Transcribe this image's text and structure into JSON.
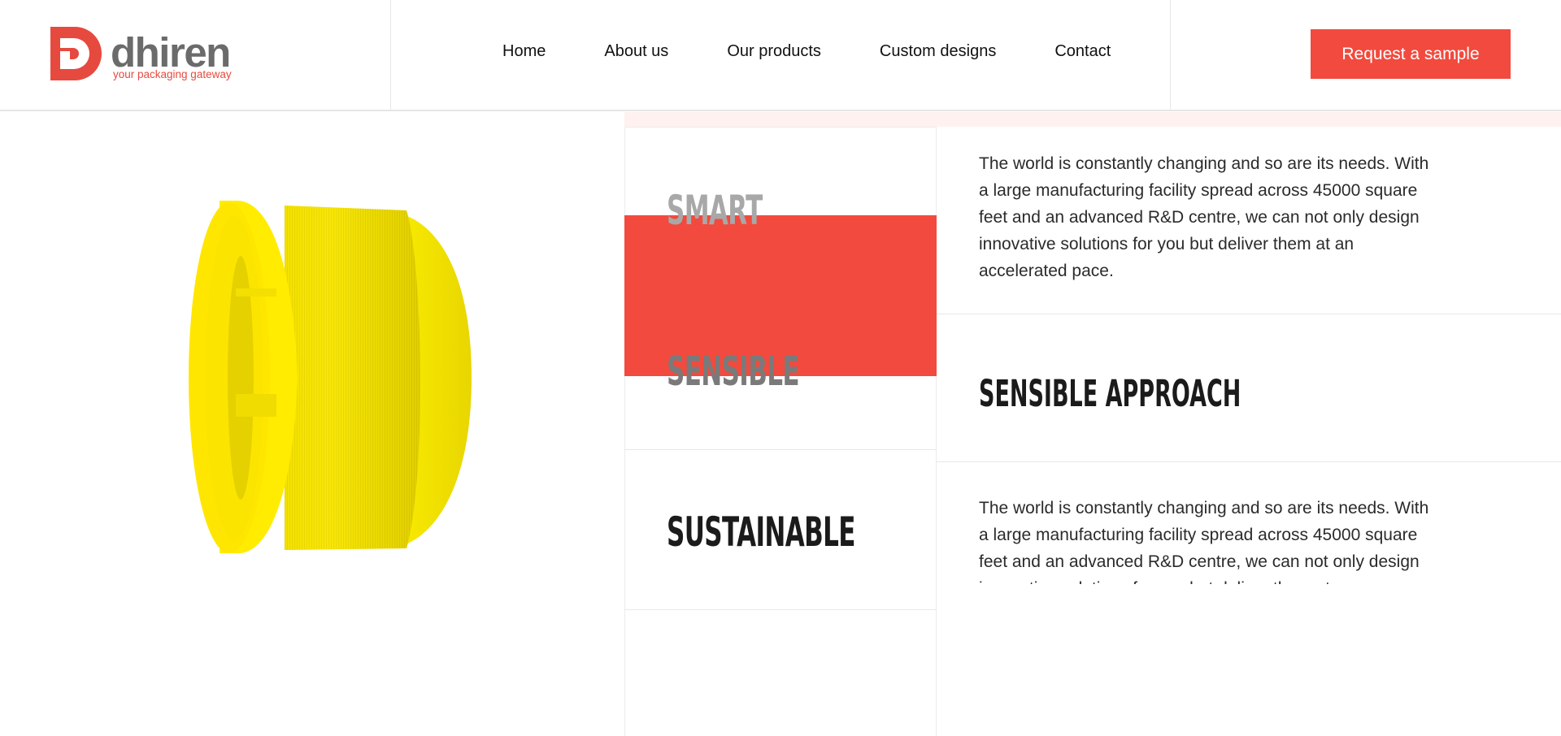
{
  "brand": {
    "name": "dhiren",
    "tagline": "your packaging gateway",
    "accent_color": "#f24a3e",
    "text_color": "#6b6b6b"
  },
  "nav": {
    "items": [
      "Home",
      "About us",
      "Our products",
      "Custom designs",
      "Contact"
    ]
  },
  "cta": {
    "label": "Request a sample"
  },
  "product": {
    "image": "yellow-bottle-cap"
  },
  "features": {
    "words": [
      "SMART",
      "SENSIBLE",
      "SUSTAINABLE"
    ],
    "active": "SENSIBLE",
    "paragraph_top": "The world is constantly changing and so are its needs. With a large manufacturing facility spread across 45000 square feet and an advanced R&D centre, we can not only design innovative solutions for you but deliver them at an accelerated pace.",
    "heading_middle": "SENSIBLE APPROACH",
    "paragraph_bottom": "The world is constantly changing and so are its needs. With a large manufacturing facility spread across 45000 square feet and an advanced R&D centre, we can not only design innovative solutions for you but deliver them at an accelerated pace."
  }
}
